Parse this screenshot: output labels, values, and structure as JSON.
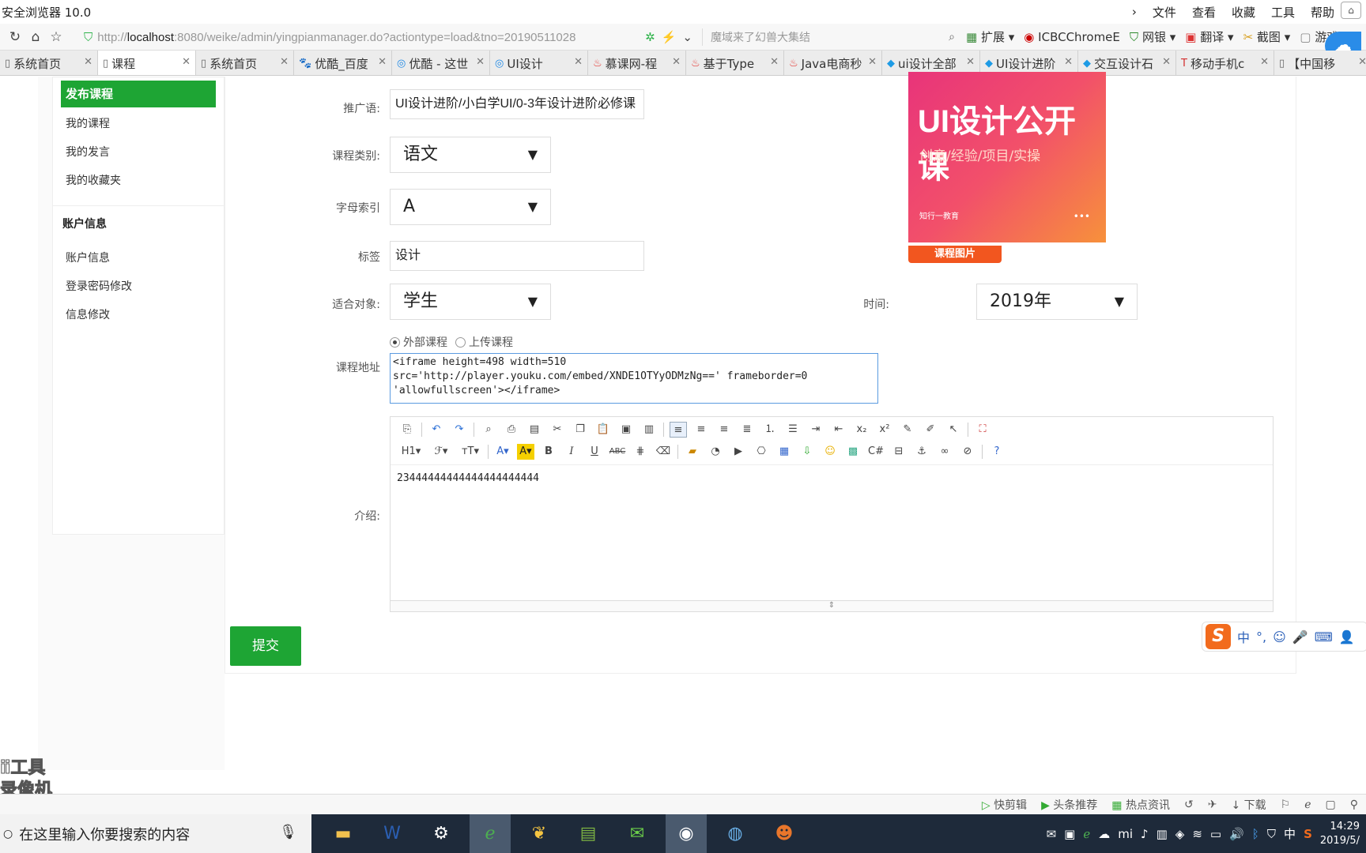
{
  "browser": {
    "title": "安全浏览器 10.0",
    "menu": [
      "文件",
      "查看",
      "收藏",
      "工具",
      "帮助"
    ],
    "url_prefix": "http://",
    "url_host": "localhost",
    "url_rest": ":8080/weike/admin/yingpianmanager.do?actiontype=load&tno=2019051102",
    "url_tail_8": "8",
    "search_placeholder": "魔域来了幻兽大集结",
    "extensions": [
      "扩展",
      "ICBCChromeE",
      "网银",
      "翻译",
      "截图",
      "游戏"
    ],
    "tabs": [
      {
        "label": "系统首页",
        "active": false,
        "icon": "page-icon"
      },
      {
        "label": "课程",
        "active": true,
        "icon": "page-icon"
      },
      {
        "label": "系统首页",
        "active": false,
        "icon": "page-icon"
      },
      {
        "label": "优酷_百度",
        "active": false,
        "icon": "baidu-icon"
      },
      {
        "label": "优酷 - 这世",
        "active": false,
        "icon": "youku-icon"
      },
      {
        "label": "UI设计",
        "active": false,
        "icon": "youku-icon"
      },
      {
        "label": "慕课网-程",
        "active": false,
        "icon": "flame-icon"
      },
      {
        "label": "基于Type",
        "active": false,
        "icon": "flame-icon"
      },
      {
        "label": "Java电商秒",
        "active": false,
        "icon": "flame-icon"
      },
      {
        "label": "ui设计全部",
        "active": false,
        "icon": "shield-icon"
      },
      {
        "label": "UI设计进阶",
        "active": false,
        "icon": "shield-icon"
      },
      {
        "label": "交互设计石",
        "active": false,
        "icon": "shield-icon"
      },
      {
        "label": "移动手机c",
        "active": false,
        "icon": "t-icon"
      },
      {
        "label": "【中国移",
        "active": false,
        "icon": "page-icon"
      }
    ]
  },
  "sidebar": {
    "active_item": "发布课程",
    "items": [
      "我的课程",
      "我的发言",
      "我的收藏夹"
    ],
    "section_title": "账户信息",
    "section_items": [
      "账户信息",
      "登录密码修改",
      "信息修改"
    ]
  },
  "form": {
    "promo_label": "推广语:",
    "promo_value": "UI设计进阶/小白学UI/0-3年设计进阶必修课",
    "category_label": "课程类别:",
    "category_value": "语文",
    "letter_label": "字母索引",
    "letter_value": "A",
    "tag_label": "标签",
    "tag_value": "设计",
    "audience_label": "适合对象:",
    "audience_value": "学生",
    "time_label": "时间:",
    "time_value": "2019年",
    "radio_external": "外部课程",
    "radio_upload": "上传课程",
    "address_label": "课程地址",
    "address_value": "<iframe height=498 width=510\nsrc='http://player.youku.com/embed/XNDE1OTYyODMzNg==' frameborder=0\n'allowfullscreen'></iframe>",
    "intro_label": "介绍:",
    "intro_value": "23444444444444444444444",
    "submit_label": "提交",
    "image_button": "课程图片",
    "image_title": "UI设计公开课",
    "image_subtitle": "创意/经验/项目/实操",
    "image_brand": "知行一教育",
    "image_dots": "•••"
  },
  "editor_toolbar": {
    "heading": "H1",
    "font": "ℱ",
    "size": "тT"
  },
  "ime": {
    "lang": "中",
    "punct": "°,"
  },
  "watermark": [
    "ⅱ工具",
    "录像机"
  ],
  "statusbar": [
    "快剪辑",
    "头条推荐",
    "热点资讯",
    "下载"
  ],
  "taskbar": {
    "search_placeholder": "在这里输入你要搜索的内容",
    "time": "14:29",
    "date": "2019/5/",
    "ime_lang": "中"
  },
  "colors": {
    "accent_green": "#1ea534",
    "image_orange": "#f2561f",
    "ime_orange": "#f26b1d"
  }
}
